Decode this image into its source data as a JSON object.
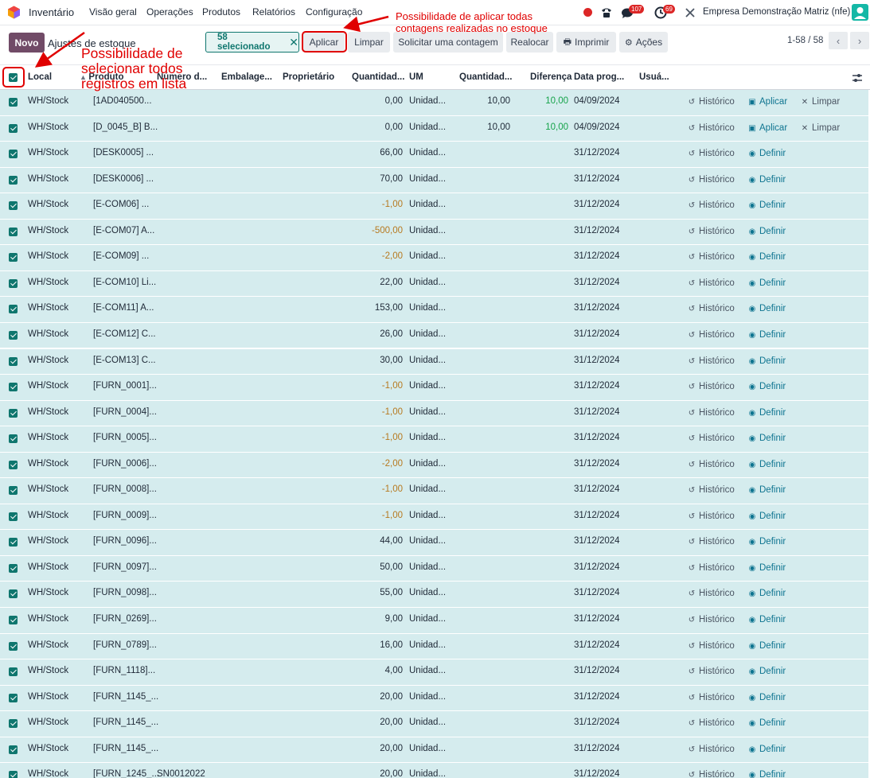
{
  "navbar": {
    "app_name": "Inventário",
    "menu": [
      "Visão geral",
      "Operações",
      "Produtos",
      "Relatórios",
      "Configuração"
    ],
    "messages_badge": "107",
    "activities_badge": "69",
    "company": "Empresa Demonstração Matriz (nfe)"
  },
  "control": {
    "new_label": "Novo",
    "breadcrumb": "Ajustes de estoque",
    "selected_label": "58 selecionado",
    "buttons": [
      "Aplicar",
      "Limpar",
      "Solicitar uma contagem",
      "Realocar",
      "Imprimir",
      "Ações"
    ],
    "pager": "1-58 / 58"
  },
  "columns": [
    "Local",
    "Produto",
    "Número d...",
    "Embalage...",
    "Proprietário",
    "Quantidad...",
    "UM",
    "Quantidad...",
    "Diferença",
    "Data prog...",
    "Usuá..."
  ],
  "actions": {
    "history": "Histórico",
    "apply": "Aplicar",
    "clear": "Limpar",
    "set": "Definir"
  },
  "rows": [
    {
      "loc": "WH/Stock",
      "prod": "[1AD040500...",
      "lot": "",
      "qty": "0,00",
      "uom": "Unidad...",
      "counted": "10,00",
      "diff": "10,00",
      "date": "04/09/2024",
      "mode": "apply"
    },
    {
      "loc": "WH/Stock",
      "prod": "[D_0045_B] B...",
      "lot": "",
      "qty": "0,00",
      "uom": "Unidad...",
      "counted": "10,00",
      "diff": "10,00",
      "date": "04/09/2024",
      "mode": "apply"
    },
    {
      "loc": "WH/Stock",
      "prod": "[DESK0005] ...",
      "lot": "",
      "qty": "66,00",
      "uom": "Unidad...",
      "counted": "",
      "diff": "",
      "date": "31/12/2024",
      "mode": "set"
    },
    {
      "loc": "WH/Stock",
      "prod": "[DESK0006] ...",
      "lot": "",
      "qty": "70,00",
      "uom": "Unidad...",
      "counted": "",
      "diff": "",
      "date": "31/12/2024",
      "mode": "set"
    },
    {
      "loc": "WH/Stock",
      "prod": "[E-COM06] ...",
      "lot": "",
      "qty": "-1,00",
      "uom": "Unidad...",
      "counted": "",
      "diff": "",
      "date": "31/12/2024",
      "mode": "set"
    },
    {
      "loc": "WH/Stock",
      "prod": "[E-COM07] A...",
      "lot": "",
      "qty": "-500,00",
      "uom": "Unidad...",
      "counted": "",
      "diff": "",
      "date": "31/12/2024",
      "mode": "set"
    },
    {
      "loc": "WH/Stock",
      "prod": "[E-COM09] ...",
      "lot": "",
      "qty": "-2,00",
      "uom": "Unidad...",
      "counted": "",
      "diff": "",
      "date": "31/12/2024",
      "mode": "set"
    },
    {
      "loc": "WH/Stock",
      "prod": "[E-COM10] Li...",
      "lot": "",
      "qty": "22,00",
      "uom": "Unidad...",
      "counted": "",
      "diff": "",
      "date": "31/12/2024",
      "mode": "set"
    },
    {
      "loc": "WH/Stock",
      "prod": "[E-COM11] A...",
      "lot": "",
      "qty": "153,00",
      "uom": "Unidad...",
      "counted": "",
      "diff": "",
      "date": "31/12/2024",
      "mode": "set"
    },
    {
      "loc": "WH/Stock",
      "prod": "[E-COM12] C...",
      "lot": "",
      "qty": "26,00",
      "uom": "Unidad...",
      "counted": "",
      "diff": "",
      "date": "31/12/2024",
      "mode": "set"
    },
    {
      "loc": "WH/Stock",
      "prod": "[E-COM13] C...",
      "lot": "",
      "qty": "30,00",
      "uom": "Unidad...",
      "counted": "",
      "diff": "",
      "date": "31/12/2024",
      "mode": "set"
    },
    {
      "loc": "WH/Stock",
      "prod": "[FURN_0001]...",
      "lot": "",
      "qty": "-1,00",
      "uom": "Unidad...",
      "counted": "",
      "diff": "",
      "date": "31/12/2024",
      "mode": "set"
    },
    {
      "loc": "WH/Stock",
      "prod": "[FURN_0004]...",
      "lot": "",
      "qty": "-1,00",
      "uom": "Unidad...",
      "counted": "",
      "diff": "",
      "date": "31/12/2024",
      "mode": "set"
    },
    {
      "loc": "WH/Stock",
      "prod": "[FURN_0005]...",
      "lot": "",
      "qty": "-1,00",
      "uom": "Unidad...",
      "counted": "",
      "diff": "",
      "date": "31/12/2024",
      "mode": "set"
    },
    {
      "loc": "WH/Stock",
      "prod": "[FURN_0006]...",
      "lot": "",
      "qty": "-2,00",
      "uom": "Unidad...",
      "counted": "",
      "diff": "",
      "date": "31/12/2024",
      "mode": "set"
    },
    {
      "loc": "WH/Stock",
      "prod": "[FURN_0008]...",
      "lot": "",
      "qty": "-1,00",
      "uom": "Unidad...",
      "counted": "",
      "diff": "",
      "date": "31/12/2024",
      "mode": "set"
    },
    {
      "loc": "WH/Stock",
      "prod": "[FURN_0009]...",
      "lot": "",
      "qty": "-1,00",
      "uom": "Unidad...",
      "counted": "",
      "diff": "",
      "date": "31/12/2024",
      "mode": "set"
    },
    {
      "loc": "WH/Stock",
      "prod": "[FURN_0096]...",
      "lot": "",
      "qty": "44,00",
      "uom": "Unidad...",
      "counted": "",
      "diff": "",
      "date": "31/12/2024",
      "mode": "set"
    },
    {
      "loc": "WH/Stock",
      "prod": "[FURN_0097]...",
      "lot": "",
      "qty": "50,00",
      "uom": "Unidad...",
      "counted": "",
      "diff": "",
      "date": "31/12/2024",
      "mode": "set"
    },
    {
      "loc": "WH/Stock",
      "prod": "[FURN_0098]...",
      "lot": "",
      "qty": "55,00",
      "uom": "Unidad...",
      "counted": "",
      "diff": "",
      "date": "31/12/2024",
      "mode": "set"
    },
    {
      "loc": "WH/Stock",
      "prod": "[FURN_0269]...",
      "lot": "",
      "qty": "9,00",
      "uom": "Unidad...",
      "counted": "",
      "diff": "",
      "date": "31/12/2024",
      "mode": "set"
    },
    {
      "loc": "WH/Stock",
      "prod": "[FURN_0789]...",
      "lot": "",
      "qty": "16,00",
      "uom": "Unidad...",
      "counted": "",
      "diff": "",
      "date": "31/12/2024",
      "mode": "set"
    },
    {
      "loc": "WH/Stock",
      "prod": "[FURN_1118]...",
      "lot": "",
      "qty": "4,00",
      "uom": "Unidad...",
      "counted": "",
      "diff": "",
      "date": "31/12/2024",
      "mode": "set"
    },
    {
      "loc": "WH/Stock",
      "prod": "[FURN_1145_...",
      "lot": "",
      "qty": "20,00",
      "uom": "Unidad...",
      "counted": "",
      "diff": "",
      "date": "31/12/2024",
      "mode": "set"
    },
    {
      "loc": "WH/Stock",
      "prod": "[FURN_1145_...",
      "lot": "",
      "qty": "20,00",
      "uom": "Unidad...",
      "counted": "",
      "diff": "",
      "date": "31/12/2024",
      "mode": "set"
    },
    {
      "loc": "WH/Stock",
      "prod": "[FURN_1145_...",
      "lot": "",
      "qty": "20,00",
      "uom": "Unidad...",
      "counted": "",
      "diff": "",
      "date": "31/12/2024",
      "mode": "set"
    },
    {
      "loc": "WH/Stock",
      "prod": "[FURN_1245_...",
      "lot": "SN0012022",
      "qty": "20,00",
      "uom": "Unidad...",
      "counted": "",
      "diff": "",
      "date": "31/12/2024",
      "mode": "set"
    }
  ],
  "annotations": {
    "apply_note_line1": "Possibilidade de aplicar todas",
    "apply_note_line2": "contagens realizadas no estoque",
    "select_note_line1": "Possibilidade de",
    "select_note_line2": "selecionar todos",
    "select_note_line3": "registros em lista"
  },
  "colors": {
    "brand": "#714b67",
    "teal": "#0f766e",
    "row_bg": "#d5ecee",
    "annotation": "#e00000"
  }
}
